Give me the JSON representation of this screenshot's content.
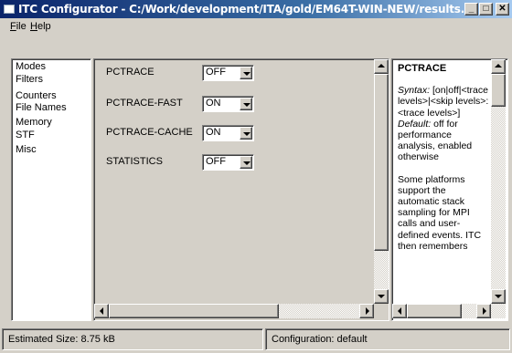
{
  "window": {
    "title": "ITC Configurator - C:/Work/development/ITA/gold/EM64T-WIN-NEW/results...",
    "minimize_glyph": "_",
    "maximize_glyph": "□",
    "close_glyph": "✕"
  },
  "menu": {
    "file_prefix": "F",
    "file_rest": "ile",
    "help_prefix": "H",
    "help_rest": "elp"
  },
  "nav": {
    "items": [
      "Modes",
      "Filters",
      "Counters",
      "File Names",
      "Memory",
      "STF",
      "Misc"
    ]
  },
  "options": [
    {
      "label": "PCTRACE",
      "value": "OFF"
    },
    {
      "label": "PCTRACE-FAST",
      "value": "ON"
    },
    {
      "label": "PCTRACE-CACHE",
      "value": "ON"
    },
    {
      "label": "STATISTICS",
      "value": "OFF"
    }
  ],
  "help": {
    "title": "PCTRACE",
    "syntax_label": "Syntax:",
    "syntax_value": " [on|off|<trace levels>|<skip levels>:<trace levels>]",
    "default_label": "Default:",
    "default_value": " off for performance analysis, enabled otherwise",
    "paragraph2": "Some platforms support the automatic stack sampling for MPI calls and user-defined events. ITC then remembers"
  },
  "status": {
    "size": "Estimated Size: 8.75 kB",
    "configuration": "Configuration: default"
  }
}
